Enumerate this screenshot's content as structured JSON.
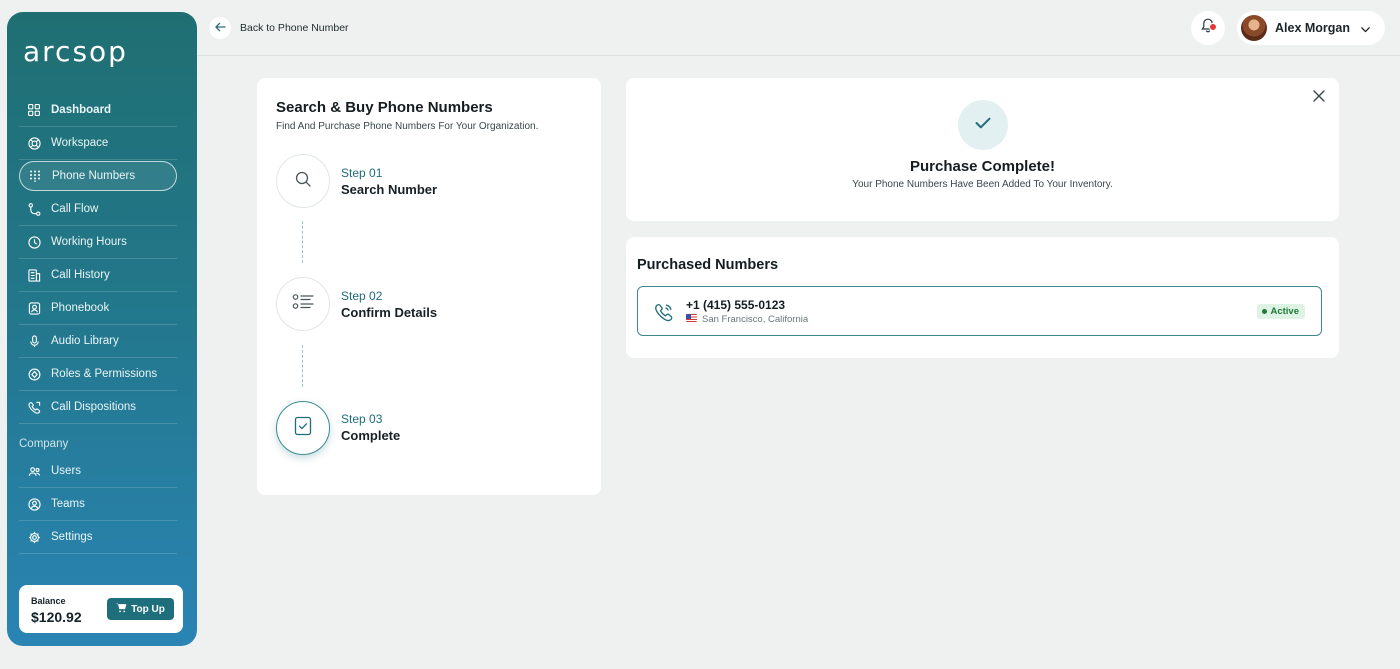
{
  "brand": {
    "logo_text": "arcsop"
  },
  "sidebar": {
    "items": [
      {
        "label": "Dashboard",
        "icon": "grid-icon"
      },
      {
        "label": "Workspace",
        "icon": "lifebuoy-icon"
      },
      {
        "label": "Phone Numbers",
        "icon": "dialpad-icon"
      },
      {
        "label": "Call Flow",
        "icon": "flow-icon"
      },
      {
        "label": "Working Hours",
        "icon": "clock-icon"
      },
      {
        "label": "Call History",
        "icon": "history-icon"
      },
      {
        "label": "Phonebook",
        "icon": "contact-book-icon"
      },
      {
        "label": "Audio Library",
        "icon": "microphone-icon"
      },
      {
        "label": "Roles & Permissions",
        "icon": "shield-icon"
      },
      {
        "label": "Call Dispositions",
        "icon": "phone-icon"
      }
    ],
    "section_company": "Company",
    "company_items": [
      {
        "label": "Users",
        "icon": "users-icon"
      },
      {
        "label": "Teams",
        "icon": "team-icon"
      },
      {
        "label": "Settings",
        "icon": "gear-icon"
      }
    ],
    "balance": {
      "label": "Balance",
      "value": "$120.92",
      "topup_label": "Top Up"
    }
  },
  "header": {
    "back_label": "Back to Phone Number",
    "user_name": "Alex Morgan"
  },
  "steps": {
    "title": "Search & Buy Phone Numbers",
    "subtitle": "Find And Purchase Phone Numbers For Your Organization.",
    "list": [
      {
        "num": "Step 01",
        "name": "Search Number"
      },
      {
        "num": "Step 02",
        "name": "Confirm Details"
      },
      {
        "num": "Step 03",
        "name": "Complete"
      }
    ]
  },
  "complete": {
    "title": "Purchase Complete!",
    "subtitle": "Your Phone Numbers Have Been Added To Your Inventory."
  },
  "purchased": {
    "title": "Purchased Numbers",
    "numbers": [
      {
        "number": "+1 (415) 555-0123",
        "location": "San Francisco, California",
        "status": "Active"
      }
    ]
  },
  "colors": {
    "accent": "#1f6e7c",
    "active_green": "#1f7a3a",
    "alert_red": "#e23a3a"
  }
}
